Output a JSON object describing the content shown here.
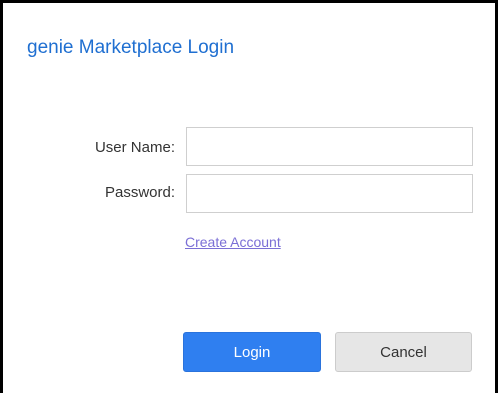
{
  "dialog": {
    "title": "genie Marketplace Login"
  },
  "form": {
    "username": {
      "label": "User Name:",
      "value": "",
      "placeholder": ""
    },
    "password": {
      "label": "Password:",
      "value": "",
      "placeholder": ""
    },
    "create_account_link": "Create Account"
  },
  "actions": {
    "login_label": "Login",
    "cancel_label": "Cancel"
  },
  "colors": {
    "title": "#1f6fd1",
    "login_button": "#2f7ff0",
    "cancel_button": "#e6e6e6",
    "link": "#7b6fd6"
  }
}
